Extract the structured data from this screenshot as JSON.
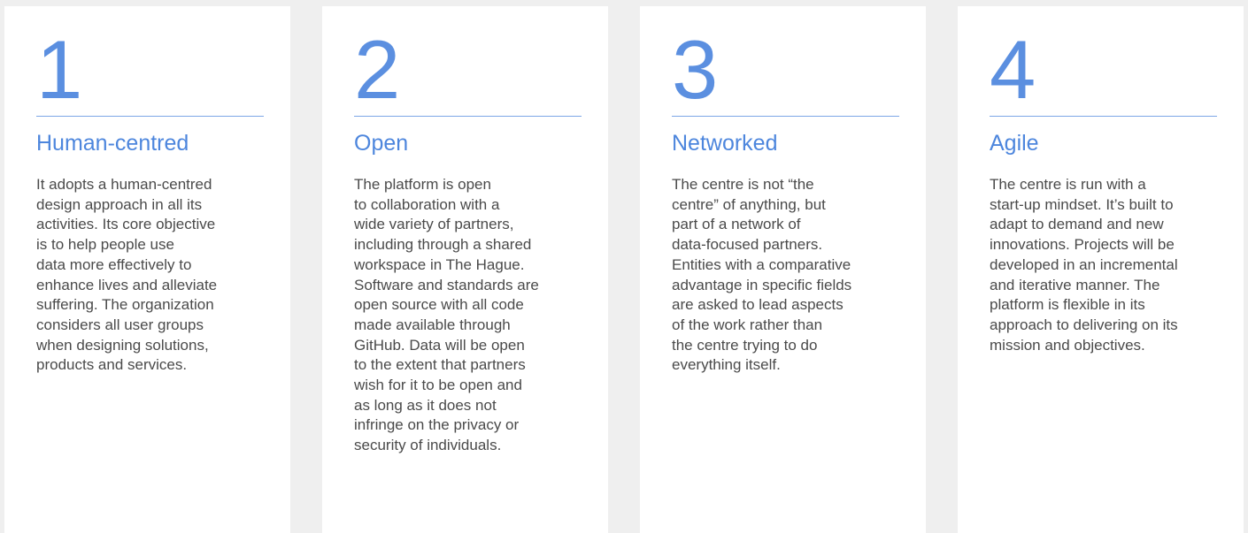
{
  "principles": [
    {
      "number": "1",
      "title": "Human-centred",
      "lines": [
        "It adopts a human-centred",
        "design approach in all its",
        "activities. Its core objective",
        "is to help people use",
        "data more effectively to",
        "enhance lives and alleviate",
        "suffering. The organization",
        "considers all user groups",
        "when designing solutions,",
        "products and services."
      ]
    },
    {
      "number": "2",
      "title": "Open",
      "lines": [
        "The platform is open",
        "to collaboration with a",
        "wide variety of partners,",
        "including through a shared",
        "workspace in The Hague.",
        "Software and standards are",
        "open source with all code",
        "made available through",
        "GitHub. Data will be open",
        "to the extent that partners",
        "wish for it to be open and",
        "as long as it does not",
        "infringe on the privacy or",
        "security of individuals."
      ]
    },
    {
      "number": "3",
      "title": "Networked",
      "lines": [
        "The centre is not “the",
        "centre” of anything, but",
        "part of a network of",
        "data-focused partners.",
        "Entities with a comparative",
        "advantage in specific fields",
        "are asked to lead aspects",
        "of the work rather than",
        "the centre trying to do",
        "everything itself."
      ]
    },
    {
      "number": "4",
      "title": "Agile",
      "lines": [
        "The centre is run with a",
        "start-up mindset. It’s built to",
        "adapt to demand and new",
        "innovations. Projects will be",
        "developed in an incremental",
        "and iterative manner. The",
        "platform is flexible in its",
        "approach to delivering on its",
        "mission and objectives."
      ]
    }
  ],
  "colors": {
    "page_background": "#efefef",
    "card_background": "#ffffff",
    "accent": "#5b8fe0",
    "body_text": "#4a4a4a"
  }
}
